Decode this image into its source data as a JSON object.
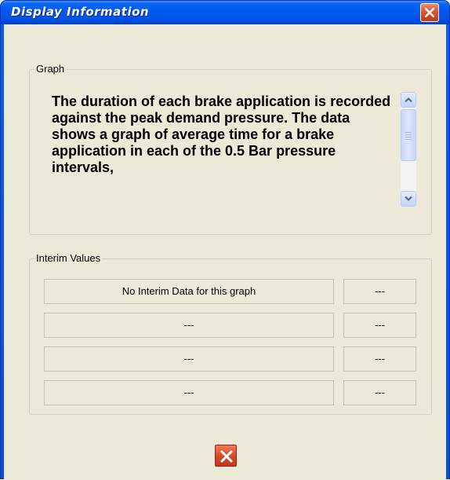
{
  "window": {
    "title": "Display Information"
  },
  "graph": {
    "group_label": "Graph",
    "description": "The duration of each brake application is recorded against the peak demand pressure. The data shows a graph of average time for a brake application in each of the 0.5 Bar pressure intervals,"
  },
  "interim": {
    "group_label": "Interim Values",
    "rows": [
      {
        "label": "No Interim Data for this graph",
        "value": "---"
      },
      {
        "label": "---",
        "value": "---"
      },
      {
        "label": "---",
        "value": "---"
      },
      {
        "label": "---",
        "value": "---"
      }
    ]
  },
  "icons": {
    "titlebar_close": "close-icon",
    "scroll_up": "chevron-up-icon",
    "scroll_down": "chevron-down-icon",
    "dialog_close": "close-icon"
  },
  "colors": {
    "titlebar_blue": "#0055e8",
    "close_red": "#d44a28",
    "dialog_face": "#ece9d8"
  }
}
